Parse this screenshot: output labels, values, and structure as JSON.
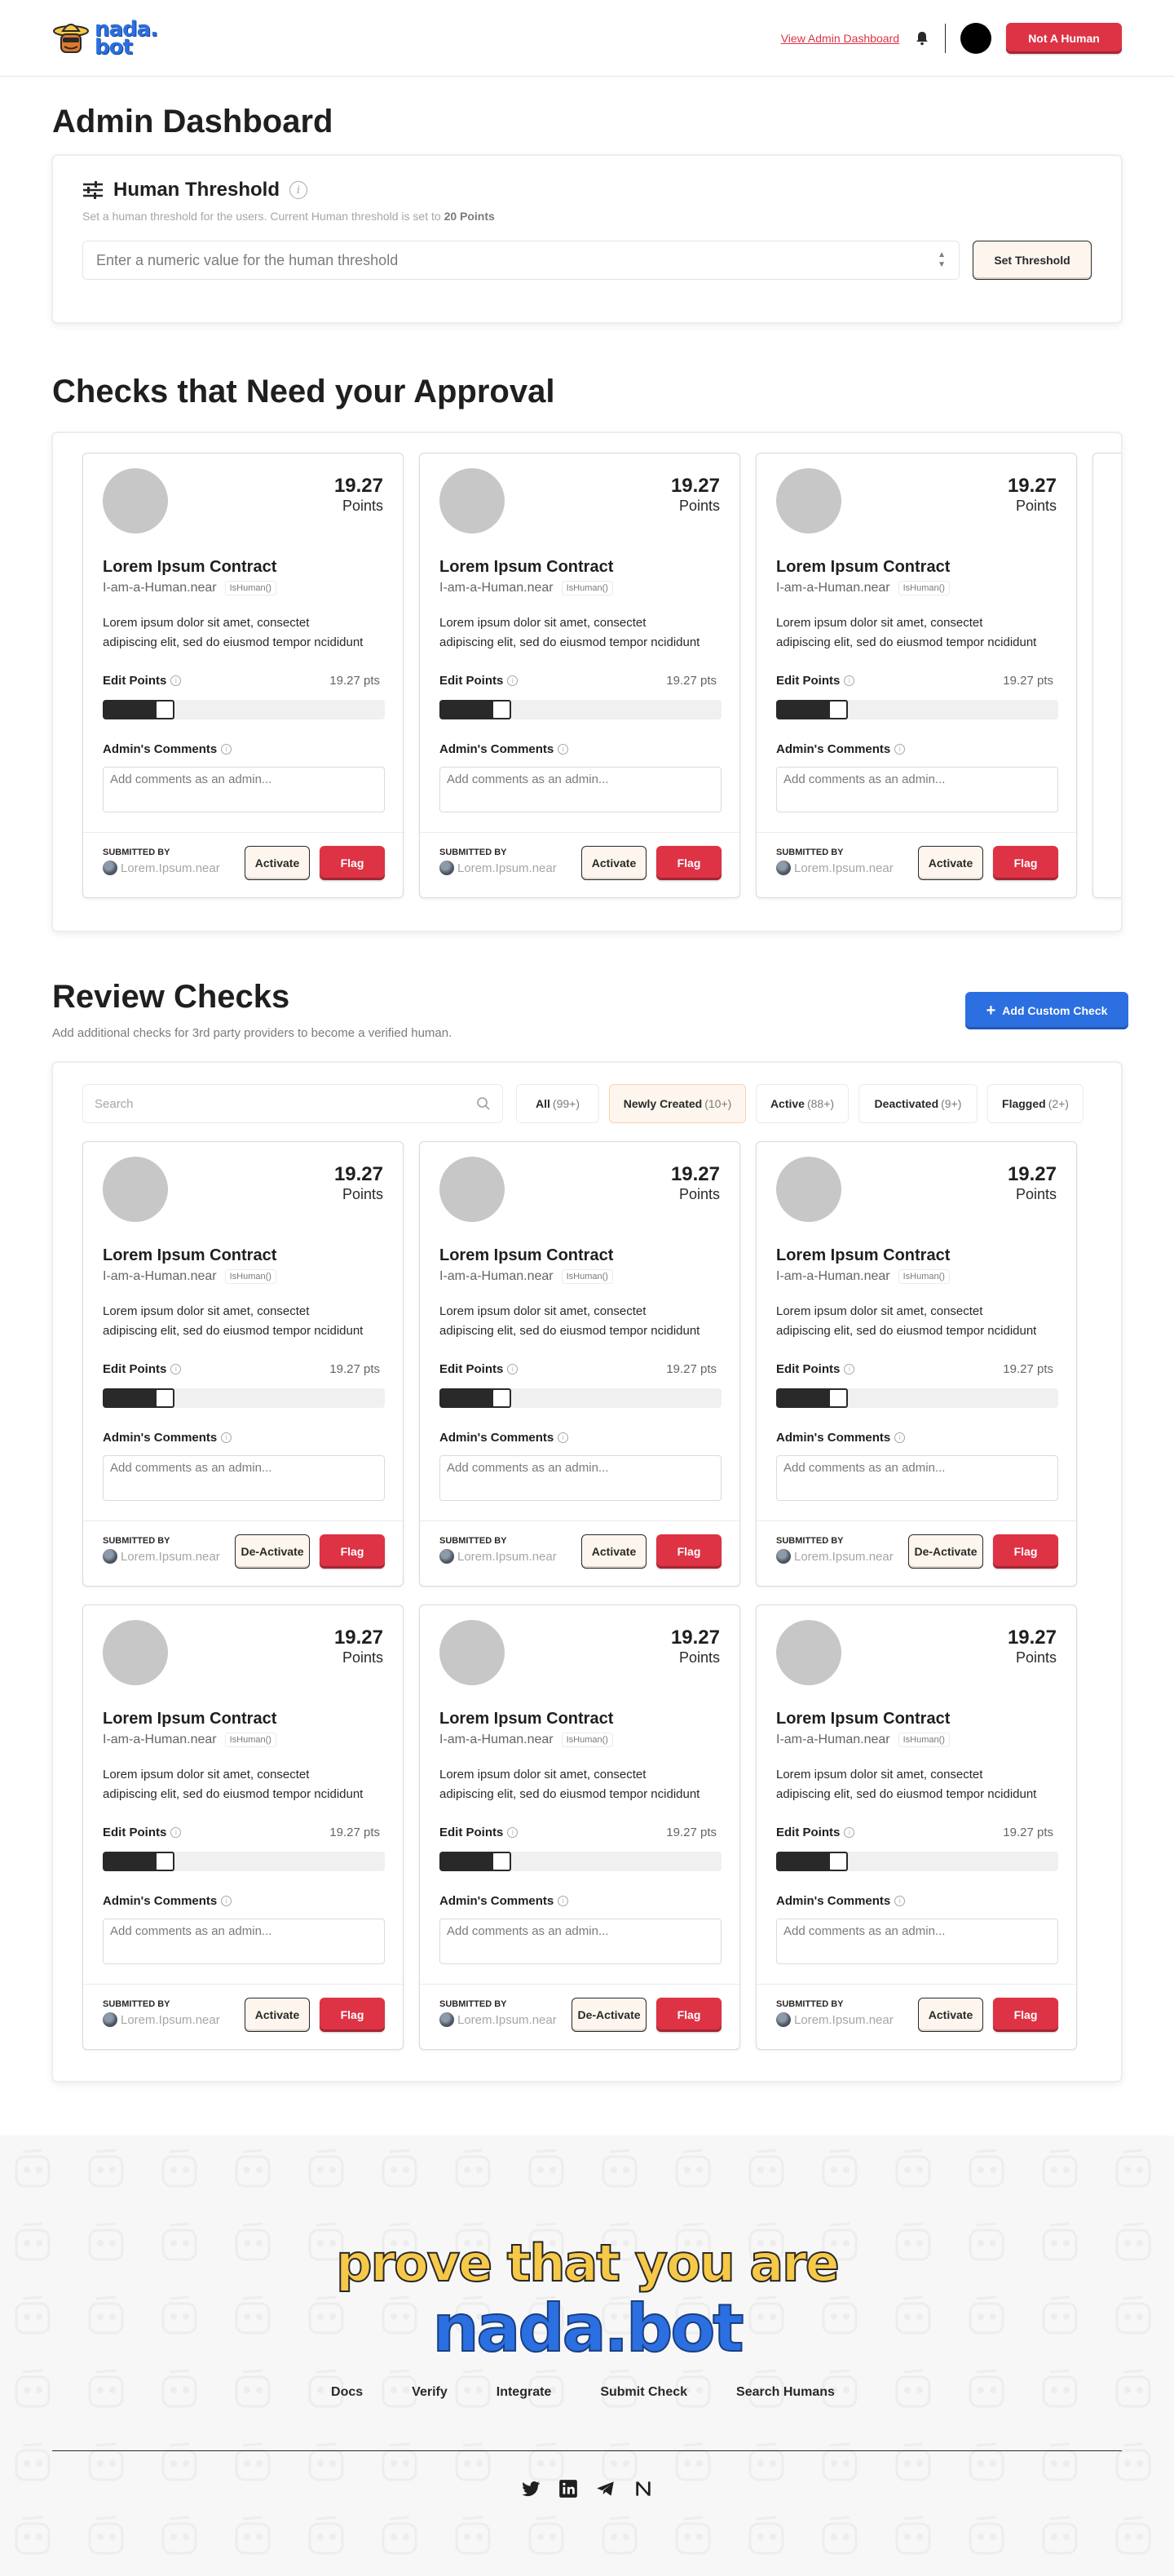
{
  "header": {
    "logo_line1": "nada.",
    "logo_line2": "bot",
    "nav_link": "View Admin Dashboard",
    "cta": "Not A Human"
  },
  "page_title": "Admin Dashboard",
  "threshold": {
    "title": "Human Threshold",
    "desc_prefix": "Set a human threshold for the users. Current Human threshold is set to ",
    "desc_value": "20 Points",
    "placeholder": "Enter a numeric value for the human threshold",
    "button": "Set Threshold"
  },
  "approval": {
    "title": "Checks that Need your Approval",
    "cards": [
      {
        "points": "19.27",
        "points_label": "Points",
        "name": "Lorem Ipsum Contract",
        "account": "I-am-a-Human.near",
        "fn": "IsHuman()",
        "desc1": "Lorem ipsum dolor sit amet, consectet",
        "desc2": "adipiscing elit, sed do eiusmod tempor ncididunt",
        "edit_label": "Edit Points",
        "edit_value": "19.27 pts",
        "slider": 0.18,
        "comments_label": "Admin's Comments",
        "comment_placeholder": "Add comments as an admin...",
        "submitted_label": "SUBMITTED BY",
        "submitter": "Lorem.Ipsum.near",
        "action": "Activate",
        "flag": "Flag"
      },
      {
        "points": "19.27",
        "points_label": "Points",
        "name": "Lorem Ipsum Contract",
        "account": "I-am-a-Human.near",
        "fn": "IsHuman()",
        "desc1": "Lorem ipsum dolor sit amet, consectet",
        "desc2": "adipiscing elit, sed do eiusmod tempor ncididunt",
        "edit_label": "Edit Points",
        "edit_value": "19.27 pts",
        "slider": 0.18,
        "comments_label": "Admin's Comments",
        "comment_placeholder": "Add comments as an admin...",
        "submitted_label": "SUBMITTED BY",
        "submitter": "Lorem.Ipsum.near",
        "action": "Activate",
        "flag": "Flag"
      },
      {
        "points": "19.27",
        "points_label": "Points",
        "name": "Lorem Ipsum Contract",
        "account": "I-am-a-Human.near",
        "fn": "IsHuman()",
        "desc1": "Lorem ipsum dolor sit amet, consectet",
        "desc2": "adipiscing elit, sed do eiusmod tempor ncididunt",
        "edit_label": "Edit Points",
        "edit_value": "19.27 pts",
        "slider": 0.18,
        "comments_label": "Admin's Comments",
        "comment_placeholder": "Add comments as an admin...",
        "submitted_label": "SUBMITTED BY",
        "submitter": "Lorem.Ipsum.near",
        "action": "Activate",
        "flag": "Flag"
      }
    ]
  },
  "review": {
    "title": "Review Checks",
    "subtitle": "Add additional checks for 3rd party providers to become a verified human.",
    "add_button": "Add Custom Check",
    "search_placeholder": "Search",
    "filters": [
      {
        "label": "All",
        "count": "(99+)"
      },
      {
        "label": "Newly Created",
        "count": "(10+)"
      },
      {
        "label": "Active",
        "count": "(88+)"
      },
      {
        "label": "Deactivated",
        "count": "(9+)"
      },
      {
        "label": "Flagged",
        "count": "(2+)"
      }
    ],
    "cards": [
      {
        "points": "19.27",
        "points_label": "Points",
        "name": "Lorem Ipsum Contract",
        "account": "I-am-a-Human.near",
        "fn": "IsHuman()",
        "desc1": "Lorem ipsum dolor sit amet, consectet",
        "desc2": "adipiscing elit, sed do eiusmod tempor ncididunt",
        "edit_label": "Edit Points",
        "edit_value": "19.27 pts",
        "slider": 0.18,
        "comments_label": "Admin's Comments",
        "comment_placeholder": "Add comments as an admin...",
        "submitted_label": "SUBMITTED BY",
        "submitter": "Lorem.Ipsum.near",
        "action": "De-Activate",
        "flag": "Flag"
      },
      {
        "points": "19.27",
        "points_label": "Points",
        "name": "Lorem Ipsum Contract",
        "account": "I-am-a-Human.near",
        "fn": "IsHuman()",
        "desc1": "Lorem ipsum dolor sit amet, consectet",
        "desc2": "adipiscing elit, sed do eiusmod tempor ncididunt",
        "edit_label": "Edit Points",
        "edit_value": "19.27 pts",
        "slider": 0.18,
        "comments_label": "Admin's Comments",
        "comment_placeholder": "Add comments as an admin...",
        "submitted_label": "SUBMITTED BY",
        "submitter": "Lorem.Ipsum.near",
        "action": "Activate",
        "flag": "Flag"
      },
      {
        "points": "19.27",
        "points_label": "Points",
        "name": "Lorem Ipsum Contract",
        "account": "I-am-a-Human.near",
        "fn": "IsHuman()",
        "desc1": "Lorem ipsum dolor sit amet, consectet",
        "desc2": "adipiscing elit, sed do eiusmod tempor ncididunt",
        "edit_label": "Edit Points",
        "edit_value": "19.27 pts",
        "slider": 0.18,
        "comments_label": "Admin's Comments",
        "comment_placeholder": "Add comments as an admin...",
        "submitted_label": "SUBMITTED BY",
        "submitter": "Lorem.Ipsum.near",
        "action": "De-Activate",
        "flag": "Flag"
      },
      {
        "points": "19.27",
        "points_label": "Points",
        "name": "Lorem Ipsum Contract",
        "account": "I-am-a-Human.near",
        "fn": "IsHuman()",
        "desc1": "Lorem ipsum dolor sit amet, consectet",
        "desc2": "adipiscing elit, sed do eiusmod tempor ncididunt",
        "edit_label": "Edit Points",
        "edit_value": "19.27 pts",
        "slider": 0.18,
        "comments_label": "Admin's Comments",
        "comment_placeholder": "Add comments as an admin...",
        "submitted_label": "SUBMITTED BY",
        "submitter": "Lorem.Ipsum.near",
        "action": "Activate",
        "flag": "Flag"
      },
      {
        "points": "19.27",
        "points_label": "Points",
        "name": "Lorem Ipsum Contract",
        "account": "I-am-a-Human.near",
        "fn": "IsHuman()",
        "desc1": "Lorem ipsum dolor sit amet, consectet",
        "desc2": "adipiscing elit, sed do eiusmod tempor ncididunt",
        "edit_label": "Edit Points",
        "edit_value": "19.27 pts",
        "slider": 0.18,
        "comments_label": "Admin's Comments",
        "comment_placeholder": "Add comments as an admin...",
        "submitted_label": "SUBMITTED BY",
        "submitter": "Lorem.Ipsum.near",
        "action": "De-Activate",
        "flag": "Flag"
      },
      {
        "points": "19.27",
        "points_label": "Points",
        "name": "Lorem Ipsum Contract",
        "account": "I-am-a-Human.near",
        "fn": "IsHuman()",
        "desc1": "Lorem ipsum dolor sit amet, consectet",
        "desc2": "adipiscing elit, sed do eiusmod tempor ncididunt",
        "edit_label": "Edit Points",
        "edit_value": "19.27 pts",
        "slider": 0.18,
        "comments_label": "Admin's Comments",
        "comment_placeholder": "Add comments as an admin...",
        "submitted_label": "SUBMITTED BY",
        "submitter": "Lorem.Ipsum.near",
        "action": "Activate",
        "flag": "Flag"
      }
    ]
  },
  "footer": {
    "tagline": "prove that you are",
    "brand": "nada.bot",
    "links": [
      "Docs",
      "Verify",
      "Integrate",
      "Submit Check",
      "Search Humans"
    ]
  },
  "colors": {
    "accent_red": "#dd3345",
    "accent_blue": "#2b6fe0",
    "cream": "#fef6ee",
    "logo_yellow": "#f7c948"
  }
}
